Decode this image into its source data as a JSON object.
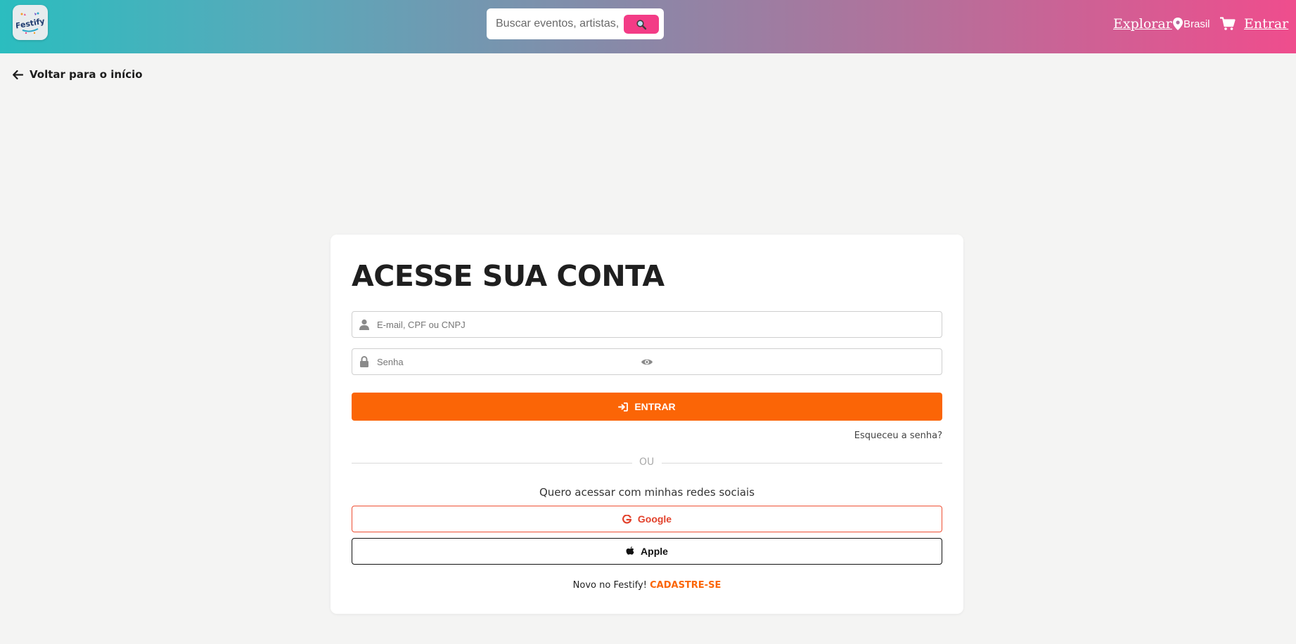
{
  "header": {
    "logo_text": "Festify",
    "search": {
      "placeholder": "Buscar eventos, artistas, locais...",
      "button_icon": "search-icon"
    },
    "nav": {
      "explore": "Explorar",
      "location": "Brasil",
      "login": "Entrar"
    },
    "icons": {
      "location": "map-pin-icon",
      "cart": "cart-icon"
    }
  },
  "back_link": {
    "label": "Voltar para o início",
    "icon": "arrow-left-icon"
  },
  "login_card": {
    "title": "ACESSE SUA CONTA",
    "user_field": {
      "placeholder": "E-mail, CPF ou CNPJ",
      "value": "",
      "icon": "user-icon"
    },
    "password_field": {
      "placeholder": "Senha",
      "value": "",
      "icon": "lock-icon",
      "toggle_icon": "eye-icon"
    },
    "submit_label": "ENTRAR",
    "forgot_label": "Esqueceu a senha?",
    "divider_label": "OU",
    "social_prompt": "Quero acessar com minhas redes sociais",
    "google_label": "Google",
    "apple_label": "Apple",
    "signup_prompt": "Novo no Festify!",
    "signup_label": "CADASTRE-SE"
  },
  "colors": {
    "accent": "#fb6506",
    "search_button": "#f33c86",
    "google": "#e2412b",
    "header_gradient": [
      "#2bbdbf",
      "#8889a8",
      "#ef4d8d"
    ]
  }
}
